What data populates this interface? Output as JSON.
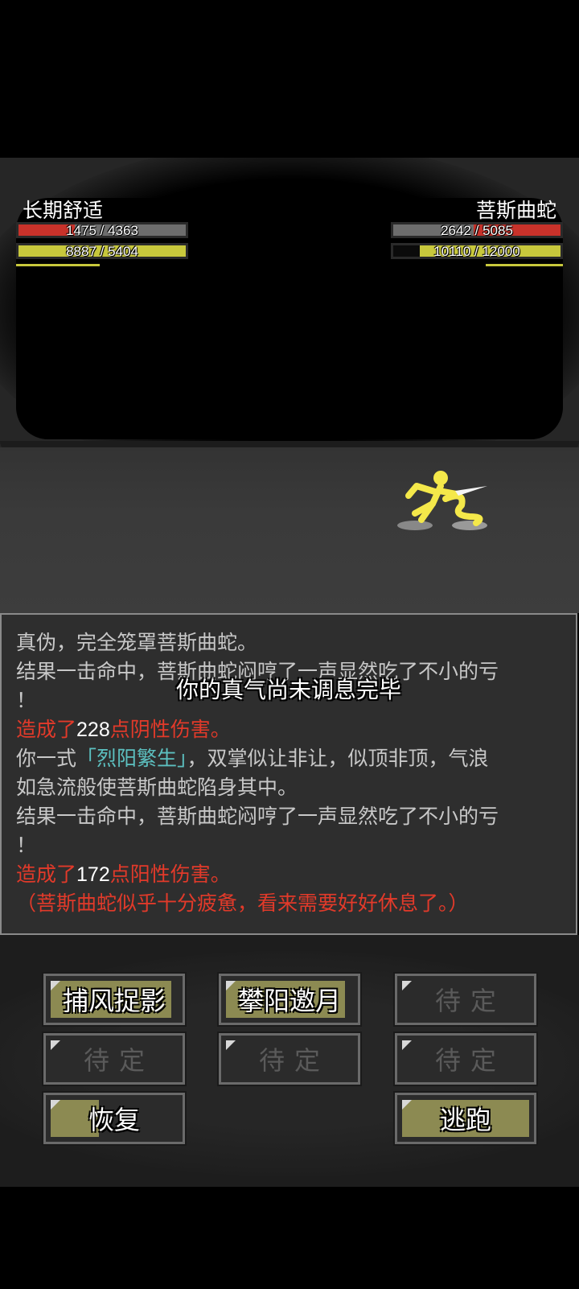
{
  "player": {
    "name": "长期舒适",
    "hp": "1475 / 4363",
    "hp_ratio": 0.338,
    "qi": "8887 / 5404",
    "qi_ratio": 1.0
  },
  "enemy": {
    "name": "菩斯曲蛇",
    "hp": "2642 / 5085",
    "hp_ratio": 0.52,
    "qi": "10110 / 12000",
    "qi_ratio": 0.8425
  },
  "log": [
    {
      "parts": [
        {
          "t": "真伪，完全笼罩菩斯曲蛇。",
          "c": "gray"
        }
      ]
    },
    {
      "parts": [
        {
          "t": "结果一击命中，菩斯曲蛇闷哼了一声显然吃了不小的亏",
          "c": "gray"
        }
      ]
    },
    {
      "parts": [
        {
          "t": "！",
          "c": "gray"
        }
      ]
    },
    {
      "parts": [
        {
          "t": "造成了",
          "c": "red"
        },
        {
          "t": "228",
          "c": "white"
        },
        {
          "t": "点阴性伤害。",
          "c": "red"
        }
      ]
    },
    {
      "parts": [
        {
          "t": "你一式",
          "c": "gray"
        },
        {
          "t": "「烈阳繁生」",
          "c": "cyan"
        },
        {
          "t": "，双掌似让非让，似顶非顶，气浪",
          "c": "gray"
        }
      ]
    },
    {
      "parts": [
        {
          "t": "如急流般使菩斯曲蛇陷身其中。",
          "c": "gray"
        }
      ]
    },
    {
      "parts": [
        {
          "t": "结果一击命中，菩斯曲蛇闷哼了一声显然吃了不小的亏",
          "c": "gray"
        }
      ]
    },
    {
      "parts": [
        {
          "t": "！",
          "c": "gray"
        }
      ]
    },
    {
      "parts": [
        {
          "t": "造成了",
          "c": "red"
        },
        {
          "t": "172",
          "c": "white"
        },
        {
          "t": "点阳性伤害。",
          "c": "red"
        }
      ]
    },
    {
      "parts": [
        {
          "t": "（菩斯曲蛇似乎十分疲惫，看来需要好好休息了。）",
          "c": "red"
        }
      ]
    }
  ],
  "toast": "你的真气尚未调息完毕",
  "actions": {
    "skill1": "捕风捉影",
    "skill2": "攀阳邀月",
    "slot3": "待定",
    "slot4": "待定",
    "slot5": "待定",
    "slot6": "待定",
    "recover": "恢复",
    "flee": "逃跑"
  }
}
